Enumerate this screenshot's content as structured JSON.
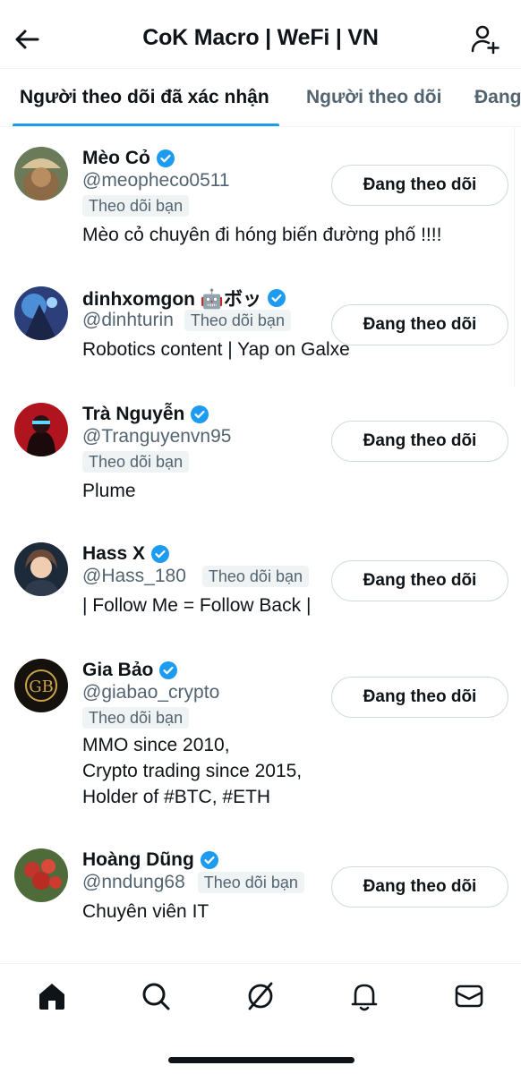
{
  "header": {
    "title": "CoK Macro | WeFi | VN",
    "back_icon": "back-arrow-icon",
    "add_icon": "add-person-icon"
  },
  "tabs": [
    {
      "label": "Người theo dõi đã xác nhận",
      "active": true
    },
    {
      "label": "Người theo dõi",
      "active": false
    },
    {
      "label": "Đang",
      "active": false
    }
  ],
  "accent_color": "#1d9bf0",
  "follow_button_label": "Đang theo dõi",
  "follows_you_label": "Theo dõi bạn",
  "users": [
    {
      "name": "Mèo Cỏ",
      "handle": "@meopheco0511",
      "bio": "Mèo cỏ chuyên đi hóng biến đường phố !!!!"
    },
    {
      "name": "dinhxomgon 🤖ボッ",
      "handle": "@dinhturin",
      "bio": "Robotics content | Yap on Galxe"
    },
    {
      "name": "Trà Nguyễn",
      "handle": "@Tranguyenvn95",
      "bio": "Plume"
    },
    {
      "name": "Hass X",
      "handle": "@Hass_180",
      "bio": "| Follow Me = Follow Back |"
    },
    {
      "name": "Gia Bảo",
      "handle": "@giabao_crypto",
      "bio": "MMO since 2010,\nCrypto trading since 2015,\nHolder of #BTC, #ETH"
    },
    {
      "name": "Hoàng Dũng",
      "handle": "@nndung68",
      "bio": "Chuyên viên IT"
    }
  ],
  "bottom_nav": [
    "home-icon",
    "search-icon",
    "grok-icon",
    "notifications-icon",
    "messages-icon"
  ]
}
